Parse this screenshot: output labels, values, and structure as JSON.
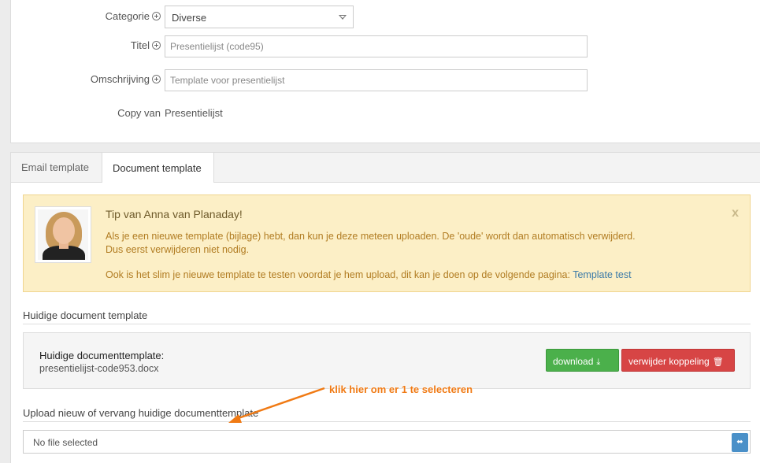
{
  "form": {
    "categorie_label": "Categorie",
    "categorie_value": "Diverse",
    "titel_label": "Titel",
    "titel_value": "Presentielijst (code95)",
    "omschrijving_label": "Omschrijving",
    "omschrijving_value": "Template voor presentielijst",
    "copy_label": "Copy van",
    "copy_value": "Presentielijst"
  },
  "tabs": [
    {
      "label": "Email template"
    },
    {
      "label": "Document template"
    }
  ],
  "tip": {
    "title": "Tip van Anna van Planaday!",
    "line1": "Als je een nieuwe template (bijlage) hebt, dan kun je deze meteen uploaden. De 'oude' wordt dan automatisch verwijderd.",
    "line2": "Dus eerst verwijderen niet nodig.",
    "line3": "Ook is het slim je nieuwe template te testen voordat je hem upload, dit kan je doen op de volgende pagina: ",
    "link": "Template test",
    "close": "x"
  },
  "current": {
    "section_title": "Huidige document template",
    "doc_label": "Huidige documenttemplate:",
    "doc_file": "presentielijst-code953.docx",
    "download_label": "download",
    "remove_label": "verwijder koppeling"
  },
  "upload": {
    "section_title": "Upload nieuw of vervang huidige documenttemplate",
    "placeholder": "No file selected"
  },
  "annotation": {
    "text": "klik hier om er 1 te selecteren",
    "color": "#f07a14"
  }
}
